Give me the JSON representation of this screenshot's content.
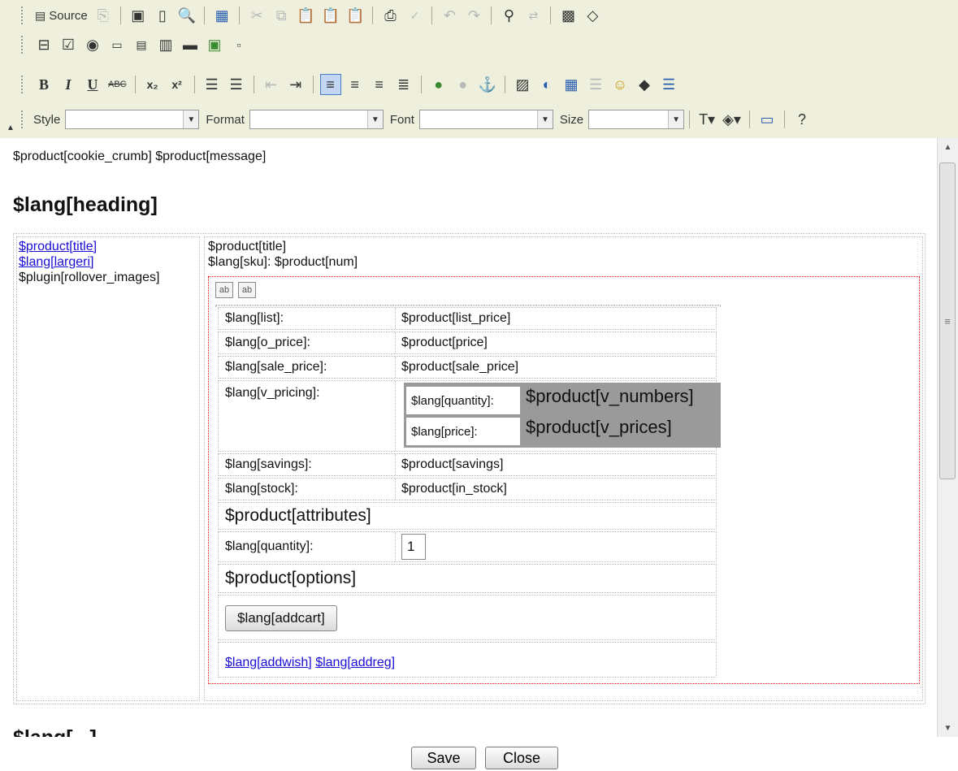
{
  "toolbar": {
    "row1": {
      "source_label": "Source",
      "buttons": [
        "newpage",
        "save",
        "new",
        "preview",
        "templates",
        "cut",
        "copy",
        "paste",
        "paste-text",
        "paste-word",
        "print",
        "spellcheck",
        "undo",
        "redo",
        "find",
        "replace",
        "select-all",
        "remove-format"
      ]
    },
    "row2": {
      "buttons": [
        "form",
        "checkbox",
        "radio",
        "textfield",
        "textarea",
        "select",
        "button",
        "imagebutton",
        "hiddenfield"
      ]
    },
    "row3": {
      "bold": "B",
      "italic": "I",
      "underline": "U",
      "strike": "ABC",
      "subscript": "x₂",
      "superscript": "x²"
    },
    "row4": {
      "style_label": "Style",
      "format_label": "Format",
      "font_label": "Font",
      "size_label": "Size",
      "style_value": "",
      "format_value": "",
      "font_value": "",
      "size_value": ""
    }
  },
  "editor": {
    "line1": "$product[cookie_crumb] $product[message]",
    "heading": "$lang[heading]",
    "left": {
      "link1": "$product[title]",
      "link2": "$lang[largeri]",
      "text1": "$plugin[rollover_images]"
    },
    "right": {
      "title": "$product[title]",
      "sku": "$lang[sku]: $product[num]"
    },
    "rows": [
      {
        "label": "$lang[list]:",
        "value": "$product[list_price]"
      },
      {
        "label": "$lang[o_price]:",
        "value": "$product[price]"
      },
      {
        "label": "$lang[sale_price]:",
        "value": "$product[sale_price]"
      },
      {
        "label": "$lang[v_pricing]:",
        "value": ""
      },
      {
        "label": "$lang[savings]:",
        "value": "$product[savings]"
      },
      {
        "label": "$lang[stock]:",
        "value": "$product[in_stock]"
      }
    ],
    "v_pricing": {
      "qty_label": "$lang[quantity]:",
      "qty_value": "$product[v_numbers]",
      "price_label": "$lang[price]:",
      "price_value": "$product[v_prices]"
    },
    "attributes": "$product[attributes]",
    "quantity_label": "$lang[quantity]:",
    "quantity_value": "1",
    "options": "$product[options]",
    "addcart": "$lang[addcart]",
    "addwish": "$lang[addwish]",
    "addreg": "$lang[addreg]",
    "cut_heading": "$lang[...]"
  },
  "footer": {
    "save": "Save",
    "close": "Close"
  }
}
